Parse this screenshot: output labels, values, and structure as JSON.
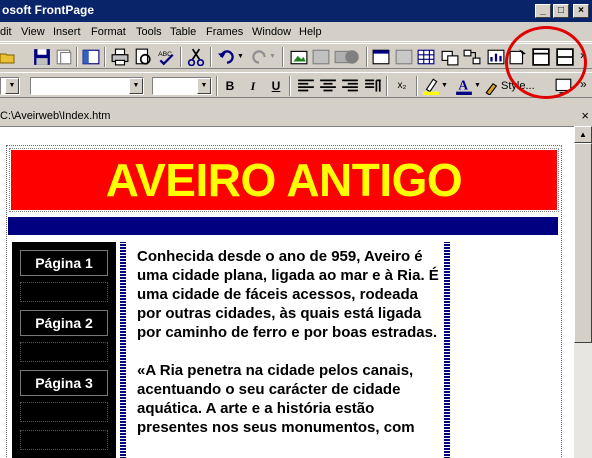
{
  "window": {
    "title": "osoft FrontPage",
    "btn_min": "_",
    "btn_max": "□",
    "btn_close": "×"
  },
  "menu": [
    {
      "label": "dit",
      "key": "edit"
    },
    {
      "label": "View",
      "key": "view"
    },
    {
      "label": "Insert",
      "key": "insert"
    },
    {
      "label": "Format",
      "key": "format"
    },
    {
      "label": "Tools",
      "key": "tools"
    },
    {
      "label": "Table",
      "key": "table"
    },
    {
      "label": "Frames",
      "key": "frames"
    },
    {
      "label": "Window",
      "key": "window"
    },
    {
      "label": "Help",
      "key": "help"
    }
  ],
  "formatting": {
    "bold": "B",
    "italic": "I",
    "underline": "U",
    "subscript": "x₂",
    "style_label": "Style..."
  },
  "document": {
    "path": "C:\\Aveirweb\\Index.htm",
    "close": "×"
  },
  "page": {
    "banner": "AVEIRO ANTIGO",
    "nav": [
      "Página 1",
      "Página 2",
      "Página 3"
    ],
    "paragraphs": [
      "Conhecida desde o ano de 959, Aveiro é uma cidade plana, ligada ao mar e à Ria. É uma cidade de fáceis acessos, rodeada por outras cidades, às quais está ligada por caminho de ferro e por boas estradas.",
      "«A Ria penetra na cidade pelos canais, acentuando o seu carácter de cidade aquática. A arte e a história estão presentes nos seus monumentos, com"
    ]
  },
  "colors": {
    "banner_bg": "#ff0000",
    "banner_text": "#ffff00",
    "band": "#000080",
    "titlebar": "#0a246a",
    "highlight": "#e00000"
  }
}
